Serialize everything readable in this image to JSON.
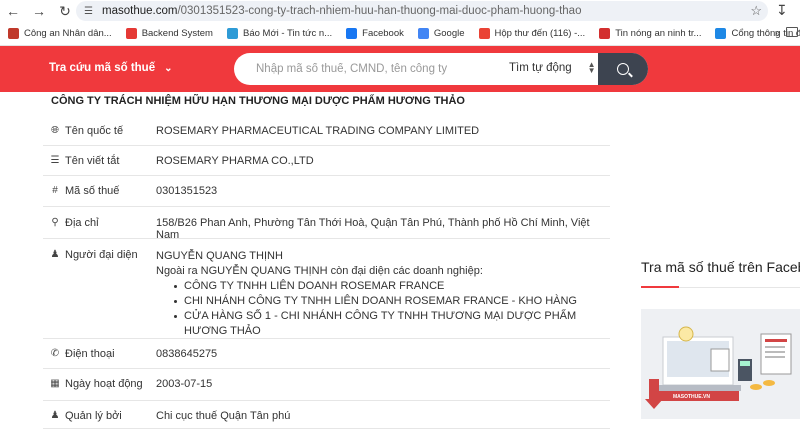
{
  "browser": {
    "url_host": "masothue.com",
    "url_path": "/0301351523-cong-ty-trach-nhiem-huu-han-thuong-mai-duoc-pham-huong-thao",
    "bookmarks": [
      {
        "label": "Công an Nhân dân...",
        "icon": "cand-icon",
        "color": "#c0392b"
      },
      {
        "label": "Backend System",
        "icon": "cms-icon",
        "color": "#e53935"
      },
      {
        "label": "Báo Mới - Tin tức n...",
        "icon": "baomoi-icon",
        "color": "#2e9bd6"
      },
      {
        "label": "Facebook",
        "icon": "facebook-icon",
        "color": "#1877f2"
      },
      {
        "label": "Google",
        "icon": "google-icon",
        "color": "#4285f4"
      },
      {
        "label": "Hộp thư đến (116) -...",
        "icon": "gmail-icon",
        "color": "#ea4335"
      },
      {
        "label": "Tin nóng an ninh tr...",
        "icon": "news-icon",
        "color": "#d32f2f"
      },
      {
        "label": "Cổng thông tin điện...",
        "icon": "portal-icon",
        "color": "#1e88e5"
      }
    ]
  },
  "header": {
    "menu_label": "Tra cứu mã số thuế",
    "search_placeholder": "Nhập mã số thuế, CMND, tên công ty",
    "search_type": "Tìm tự động",
    "accent_color": "#f0393d"
  },
  "company": {
    "title": "CÔNG TY TRÁCH NHIỆM HỮU HẠN THƯƠNG MẠI DƯỢC PHẨM HƯƠNG THẢO",
    "fields": {
      "intl_name_label": "Tên quốc tế",
      "intl_name": "ROSEMARY PHARMACEUTICAL TRADING COMPANY LIMITED",
      "short_name_label": "Tên viết tắt",
      "short_name": "ROSEMARY PHARMA CO.,LTD",
      "tax_code_label": "Mã số thuế",
      "tax_code": "0301351523",
      "address_label": "Địa chỉ",
      "address": "158/B26 Phan Anh, Phường Tân Thới Hoà, Quận Tân Phú, Thành phố Hồ Chí Minh, Việt Nam",
      "rep_label": "Người đại diện",
      "rep_name": "NGUYỄN QUANG THỊNH",
      "rep_note": "Ngoài ra NGUYỄN QUANG THỊNH còn đại diện các doanh nghiệp:",
      "rep_companies": [
        "CÔNG TY TNHH LIÊN DOANH ROSEMAR FRANCE",
        "CHI NHÁNH CÔNG TY TNHH LIÊN DOANH ROSEMAR FRANCE - KHO HÀNG",
        "CỬA HÀNG SỐ 1 - CHI NHÁNH CÔNG TY TNHH THƯƠNG MẠI DƯỢC PHẨM HƯƠNG THẢO"
      ],
      "phone_label": "Điện thoại",
      "phone": "0838645275",
      "start_date_label": "Ngày hoạt động",
      "start_date": "2003-07-15",
      "managed_by_label": "Quản lý bởi",
      "managed_by": "Chi cục thuế Quận Tân phú"
    }
  },
  "sidebar": {
    "fb_title": "Tra mã số thuế trên Facebook",
    "banner_brand": "MASOTHUE.VN"
  }
}
